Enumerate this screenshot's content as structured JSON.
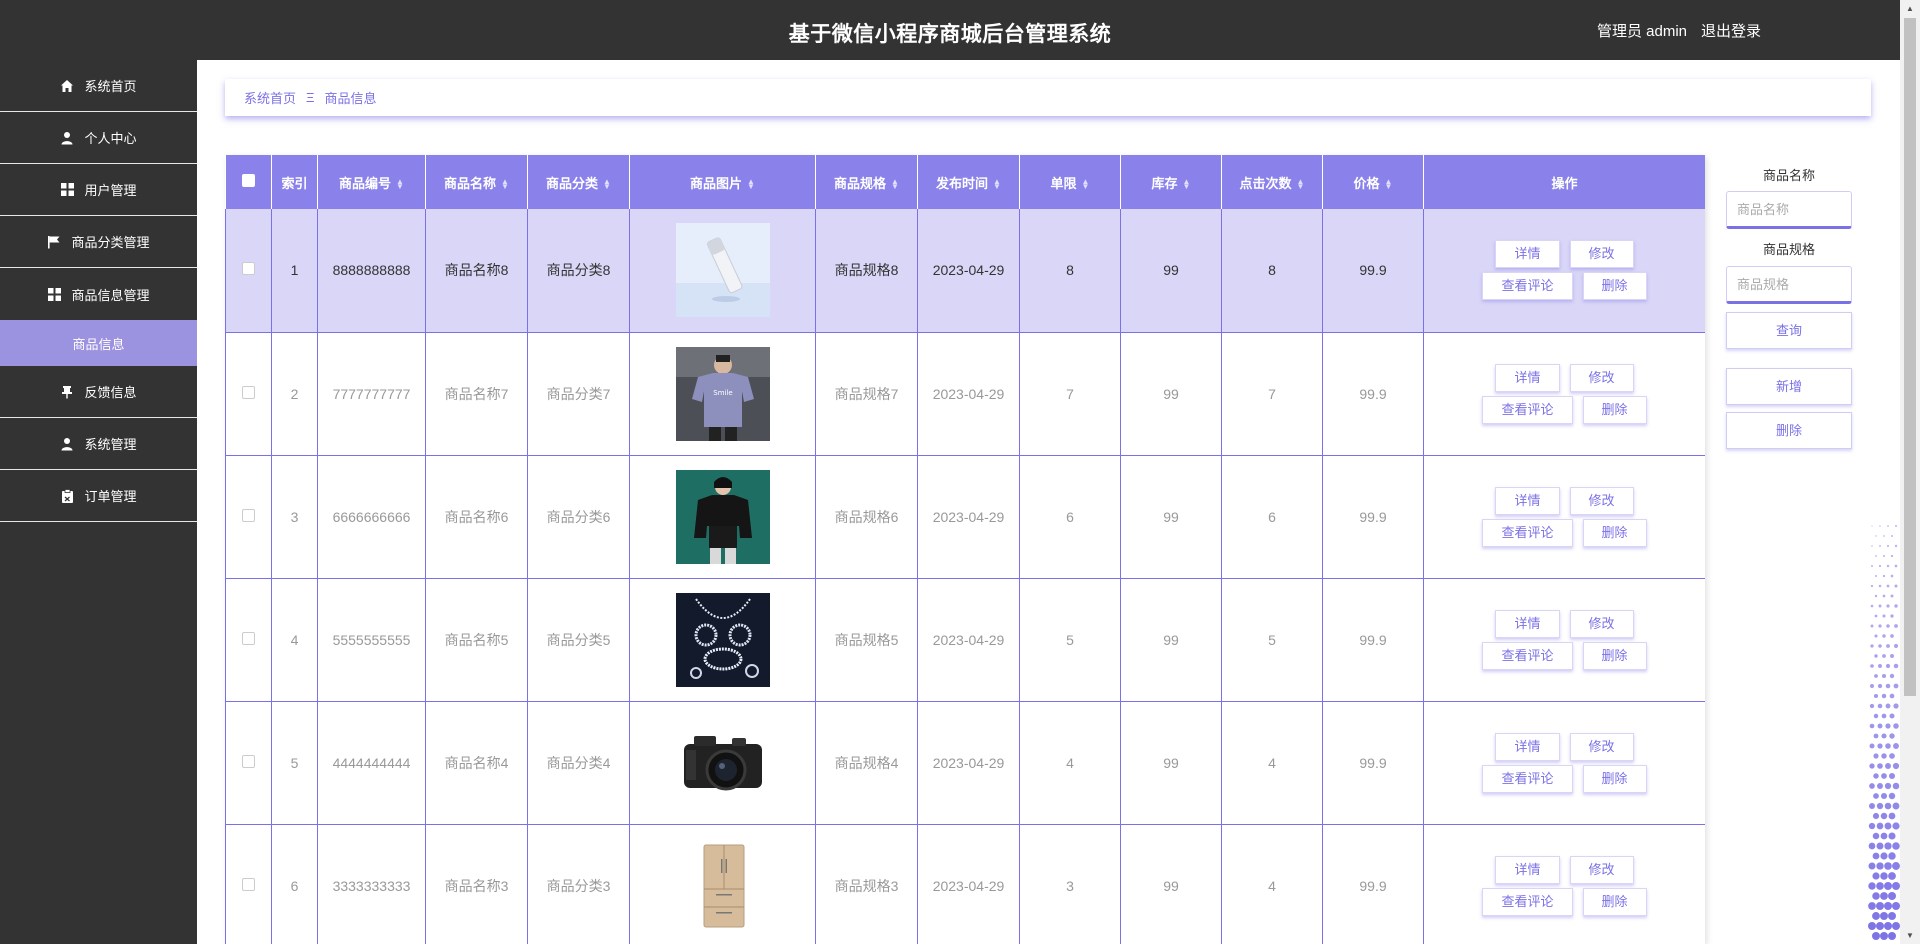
{
  "header": {
    "title": "基于微信小程序商城后台管理系统",
    "user": "管理员 admin",
    "logout": "退出登录"
  },
  "sidebar": {
    "items": [
      {
        "label": "系统首页",
        "icon": "home-icon"
      },
      {
        "label": "个人中心",
        "icon": "user-icon"
      },
      {
        "label": "用户管理",
        "icon": "grid-icon"
      },
      {
        "label": "商品分类管理",
        "icon": "flag-icon"
      },
      {
        "label": "商品信息管理",
        "icon": "grid-icon"
      },
      {
        "label": "商品信息",
        "icon": "",
        "sub": true,
        "active": true
      },
      {
        "label": "反馈信息",
        "icon": "pin-icon"
      },
      {
        "label": "系统管理",
        "icon": "user-icon"
      },
      {
        "label": "订单管理",
        "icon": "clipboard-icon"
      }
    ]
  },
  "breadcrumb": {
    "home": "系统首页",
    "separator": "Ξ",
    "current": "商品信息"
  },
  "table": {
    "columns": [
      "",
      "索引",
      "商品编号",
      "商品名称",
      "商品分类",
      "商品图片",
      "商品规格",
      "发布时间",
      "单限",
      "库存",
      "点击次数",
      "价格",
      "操作"
    ],
    "rows": [
      {
        "index": "1",
        "code": "8888888888",
        "name": "商品名称8",
        "category": "商品分类8",
        "image": "cosmetic-bottle-image",
        "spec": "商品规格8",
        "date": "2023-04-29",
        "limit": "8",
        "stock": "99",
        "clicks": "8",
        "price": "99.9"
      },
      {
        "index": "2",
        "code": "7777777777",
        "name": "商品名称7",
        "category": "商品分类7",
        "image": "tshirt-image",
        "spec": "商品规格7",
        "date": "2023-04-29",
        "limit": "7",
        "stock": "99",
        "clicks": "7",
        "price": "99.9"
      },
      {
        "index": "3",
        "code": "6666666666",
        "name": "商品名称6",
        "category": "商品分类6",
        "image": "jacket-image",
        "spec": "商品规格6",
        "date": "2023-04-29",
        "limit": "6",
        "stock": "99",
        "clicks": "6",
        "price": "99.9"
      },
      {
        "index": "4",
        "code": "5555555555",
        "name": "商品名称5",
        "category": "商品分类5",
        "image": "jewelry-image",
        "spec": "商品规格5",
        "date": "2023-04-29",
        "limit": "5",
        "stock": "99",
        "clicks": "5",
        "price": "99.9"
      },
      {
        "index": "5",
        "code": "4444444444",
        "name": "商品名称4",
        "category": "商品分类4",
        "image": "camera-image",
        "spec": "商品规格4",
        "date": "2023-04-29",
        "limit": "4",
        "stock": "99",
        "clicks": "4",
        "price": "99.9"
      },
      {
        "index": "6",
        "code": "3333333333",
        "name": "商品名称3",
        "category": "商品分类3",
        "image": "fridge-image",
        "spec": "商品规格3",
        "date": "2023-04-29",
        "limit": "3",
        "stock": "99",
        "clicks": "4",
        "price": "99.9"
      }
    ],
    "actions": {
      "detail": "详情",
      "edit": "修改",
      "comments": "查看评论",
      "delete": "删除"
    }
  },
  "filter": {
    "name_label": "商品名称",
    "name_placeholder": "商品名称",
    "spec_label": "商品规格",
    "spec_placeholder": "商品规格",
    "query": "查询",
    "add": "新增",
    "delete": "删除"
  },
  "colors": {
    "accent": "#7b71e6",
    "header": "#8a82ea",
    "dark": "#333333",
    "active": "#9b92e0",
    "row_highlight": "#d9d6f7"
  }
}
